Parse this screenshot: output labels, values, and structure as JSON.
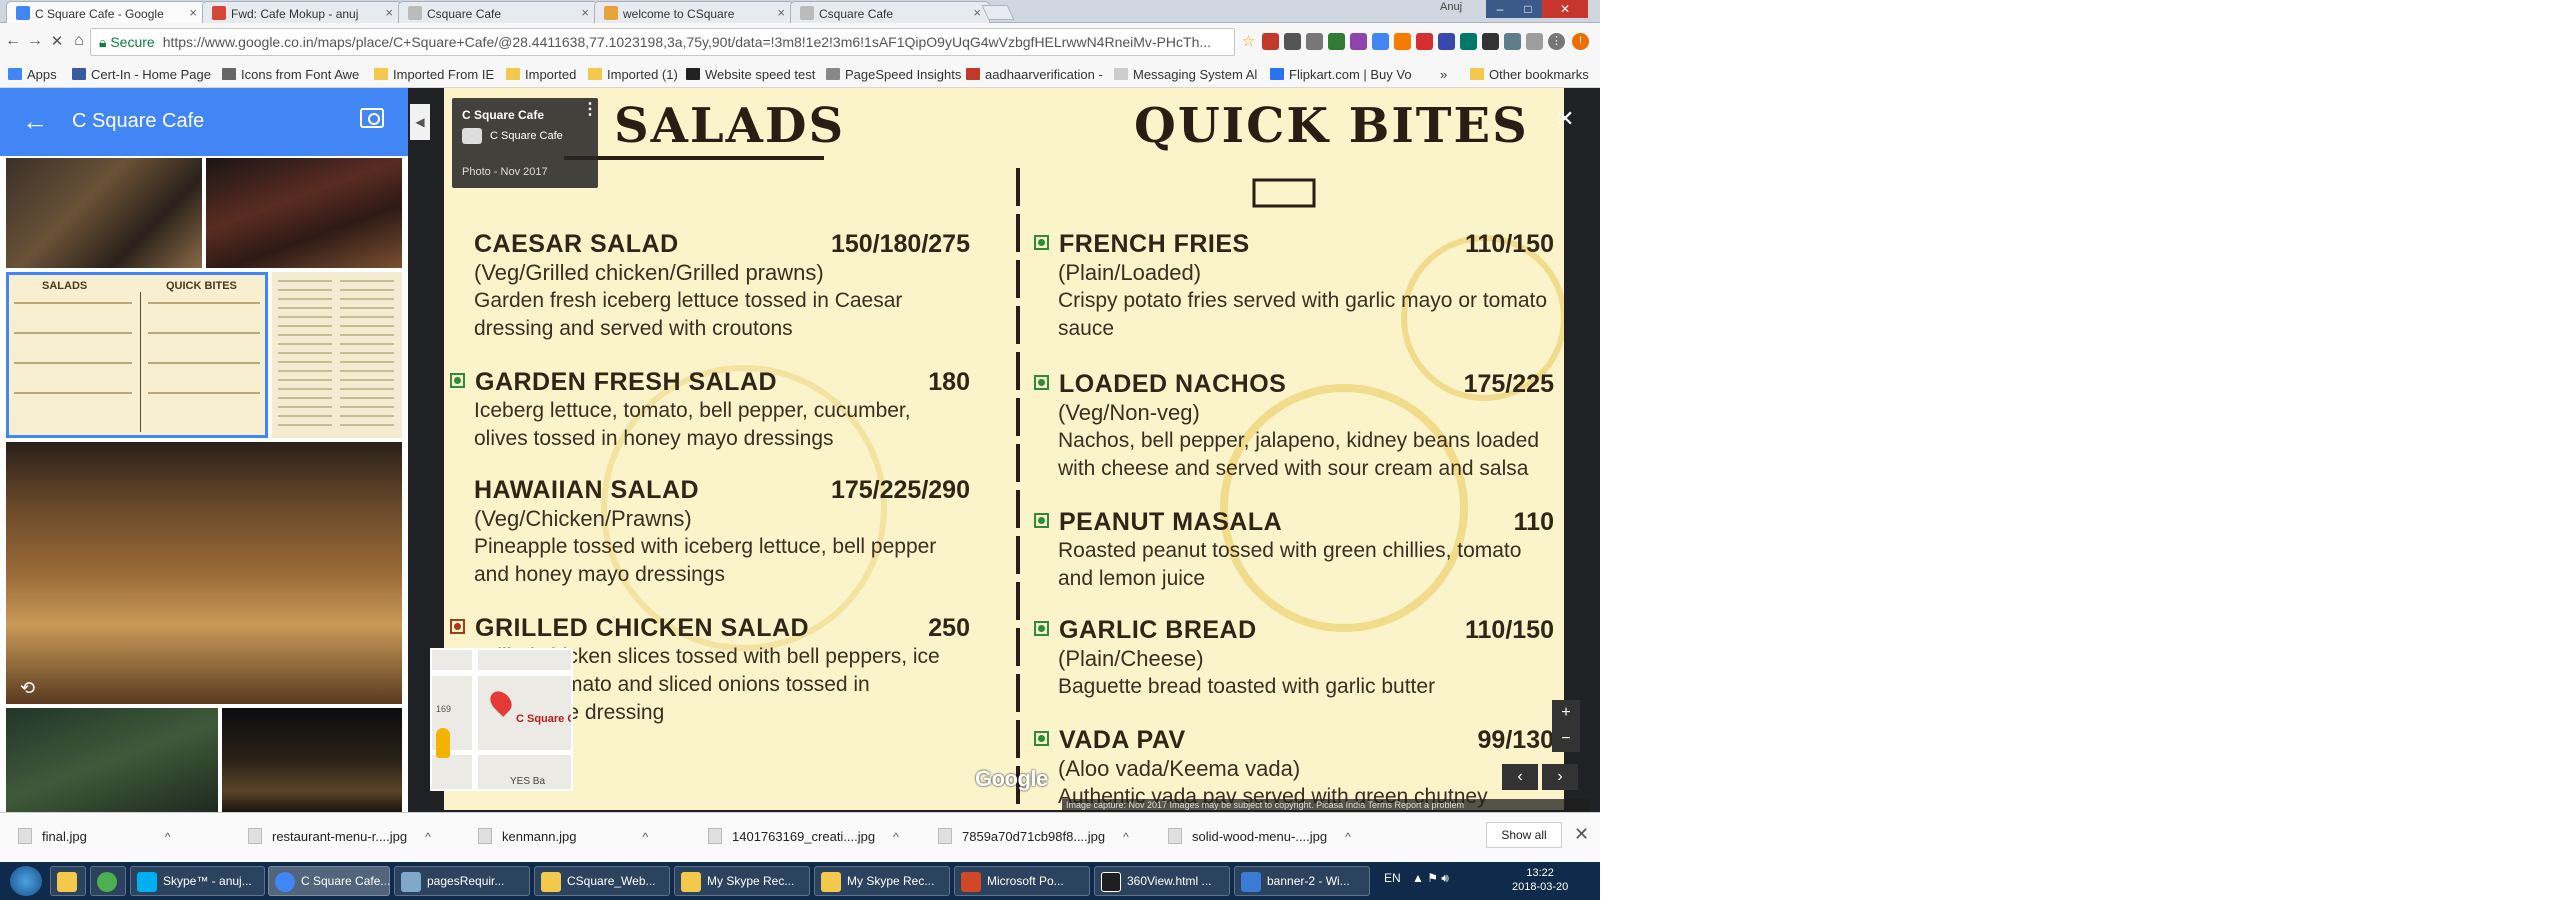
{
  "browser": {
    "tabs": [
      {
        "title": "C Square Cafe - Google",
        "fav_color": "#4285f4",
        "active": true
      },
      {
        "title": "Fwd: Cafe Mokup - anuj",
        "fav_color": "#d44638",
        "active": false
      },
      {
        "title": "Csquare Cafe",
        "fav_color": "#999999",
        "active": false
      },
      {
        "title": "welcome to CSquare",
        "fav_color": "#e7a33e",
        "active": false
      },
      {
        "title": "Csquare Cafe",
        "fav_color": "#999999",
        "active": false
      }
    ],
    "user": "Anuj",
    "address": {
      "security": "Secure",
      "url": "https://www.google.co.in/maps/place/C+Square+Cafe/@28.4411638,77.1023198,3a,75y,90t/data=!3m8!1e2!3m6!1sAF1QipO9yUqG4wVzbgfHELrwwN4RneiMv-PHcTh..."
    },
    "bookmarks": [
      {
        "label": "Apps",
        "color": "#4285f4"
      },
      {
        "label": "Cert-In - Home Page",
        "color": "#3a5ba0"
      },
      {
        "label": "Icons from Font Awe",
        "color": "#666666"
      },
      {
        "label": "Imported From IE",
        "color": "#f2c94c"
      },
      {
        "label": "Imported",
        "color": "#f2c94c"
      },
      {
        "label": "Imported (1)",
        "color": "#f2c94c"
      },
      {
        "label": "Website speed test",
        "color": "#222222"
      },
      {
        "label": "PageSpeed Insights",
        "color": "#888888"
      },
      {
        "label": "aadhaarverification -",
        "color": "#c0392b"
      },
      {
        "label": "Messaging System Al",
        "color": "#cccccc"
      },
      {
        "label": "Flipkart.com | Buy Vo",
        "color": "#2874f0"
      },
      {
        "label": "Other bookmarks",
        "color": "#f2c94c"
      }
    ],
    "bookmarks_more": "»"
  },
  "maps": {
    "place_title": "C Square Cafe",
    "card": {
      "title": "C Square Cafe",
      "name": "C Square Cafe",
      "date": "Photo - Nov 2017"
    },
    "map_label": "C Square C",
    "map_road_num": "169",
    "map_poi": "YES Ba",
    "google_logo": "Google",
    "credit": "Image capture: Nov 2017    Images may be subject to copyright.    Picasa    India    Terms    Report a problem",
    "zoom_in": "+",
    "zoom_out": "−",
    "prev": "‹",
    "next": "›",
    "close": "✕",
    "back": "←"
  },
  "menu": {
    "sections": [
      {
        "title": "SALADS"
      },
      {
        "title": "QUICK BITES"
      }
    ],
    "items": [
      {
        "name": "CAESAR SALAD",
        "price": "150/180/275",
        "sub": "(Veg/Grilled chicken/Grilled prawns)",
        "desc": "Garden fresh iceberg lettuce tossed in Caesar dressing and served with croutons",
        "mark": "none"
      },
      {
        "name": "GARDEN FRESH SALAD",
        "price": "180",
        "sub": "",
        "desc": "Iceberg lettuce, tomato, bell pepper, cucumber, olives tossed in honey mayo dressings",
        "mark": "veg"
      },
      {
        "name": "HAWAIIAN SALAD",
        "price": "175/225/290",
        "sub": "(Veg/Chicken/Prawns)",
        "desc": "Pineapple tossed with iceberg lettuce, bell pepper and honey mayo dressings",
        "mark": "none"
      },
      {
        "name": "GRILLED CHICKEN SALAD",
        "price": "250",
        "sub": "",
        "desc": "Grilled chicken slices tossed with bell peppers, ice lettuce, tomato and sliced onions tossed in homemade dressing",
        "mark": "nonveg"
      },
      {
        "name": "FRENCH FRIES",
        "price": "110/150",
        "sub": "(Plain/Loaded)",
        "desc": "Crispy potato fries served with garlic mayo or tomato sauce",
        "mark": "veg"
      },
      {
        "name": "LOADED NACHOS",
        "price": "175/225",
        "sub": "(Veg/Non-veg)",
        "desc": "Nachos, bell pepper, jalapeno, kidney beans loaded with cheese and served with sour cream and salsa",
        "mark": "veg"
      },
      {
        "name": "PEANUT MASALA",
        "price": "110",
        "sub": "",
        "desc": "Roasted peanut tossed with green chillies, tomato and lemon juice",
        "mark": "veg"
      },
      {
        "name": "GARLIC BREAD",
        "price": "110/150",
        "sub": "(Plain/Cheese)",
        "desc": "Baguette bread toasted with garlic butter",
        "mark": "veg"
      },
      {
        "name": "VADA PAV",
        "price": "99/130",
        "sub": "(Aloo vada/Keema vada)",
        "desc": "Authentic vada pav served with green chutney",
        "mark": "veg"
      }
    ]
  },
  "downloads": {
    "files": [
      "final.jpg",
      "restaurant-menu-r....jpg",
      "kenmann.jpg",
      "1401763169_creati....jpg",
      "7859a70d71cb98f8....jpg",
      "solid-wood-menu-....jpg"
    ],
    "caret": "^",
    "show_all": "Show all",
    "close": "✕"
  },
  "taskbar": {
    "items": [
      {
        "label": "Skype™ - anuj...",
        "color": "#00aff0"
      },
      {
        "label": "C Square Cafe...",
        "color": "#4285f4"
      },
      {
        "label": "pagesRequir...",
        "color": "#7fa7c9"
      },
      {
        "label": "CSquare_Web...",
        "color": "#f2c94c"
      },
      {
        "label": "My Skype Rec...",
        "color": "#f2c94c"
      },
      {
        "label": "My Skype Rec...",
        "color": "#f2c94c"
      },
      {
        "label": "Microsoft Po...",
        "color": "#d24726"
      },
      {
        "label": "360View.html ...",
        "color": "#1e1e1e"
      },
      {
        "label": "banner-2 - Wi...",
        "color": "#3a7bd5"
      }
    ],
    "lang": "EN",
    "time": "13:22",
    "date": "2018-03-20"
  }
}
